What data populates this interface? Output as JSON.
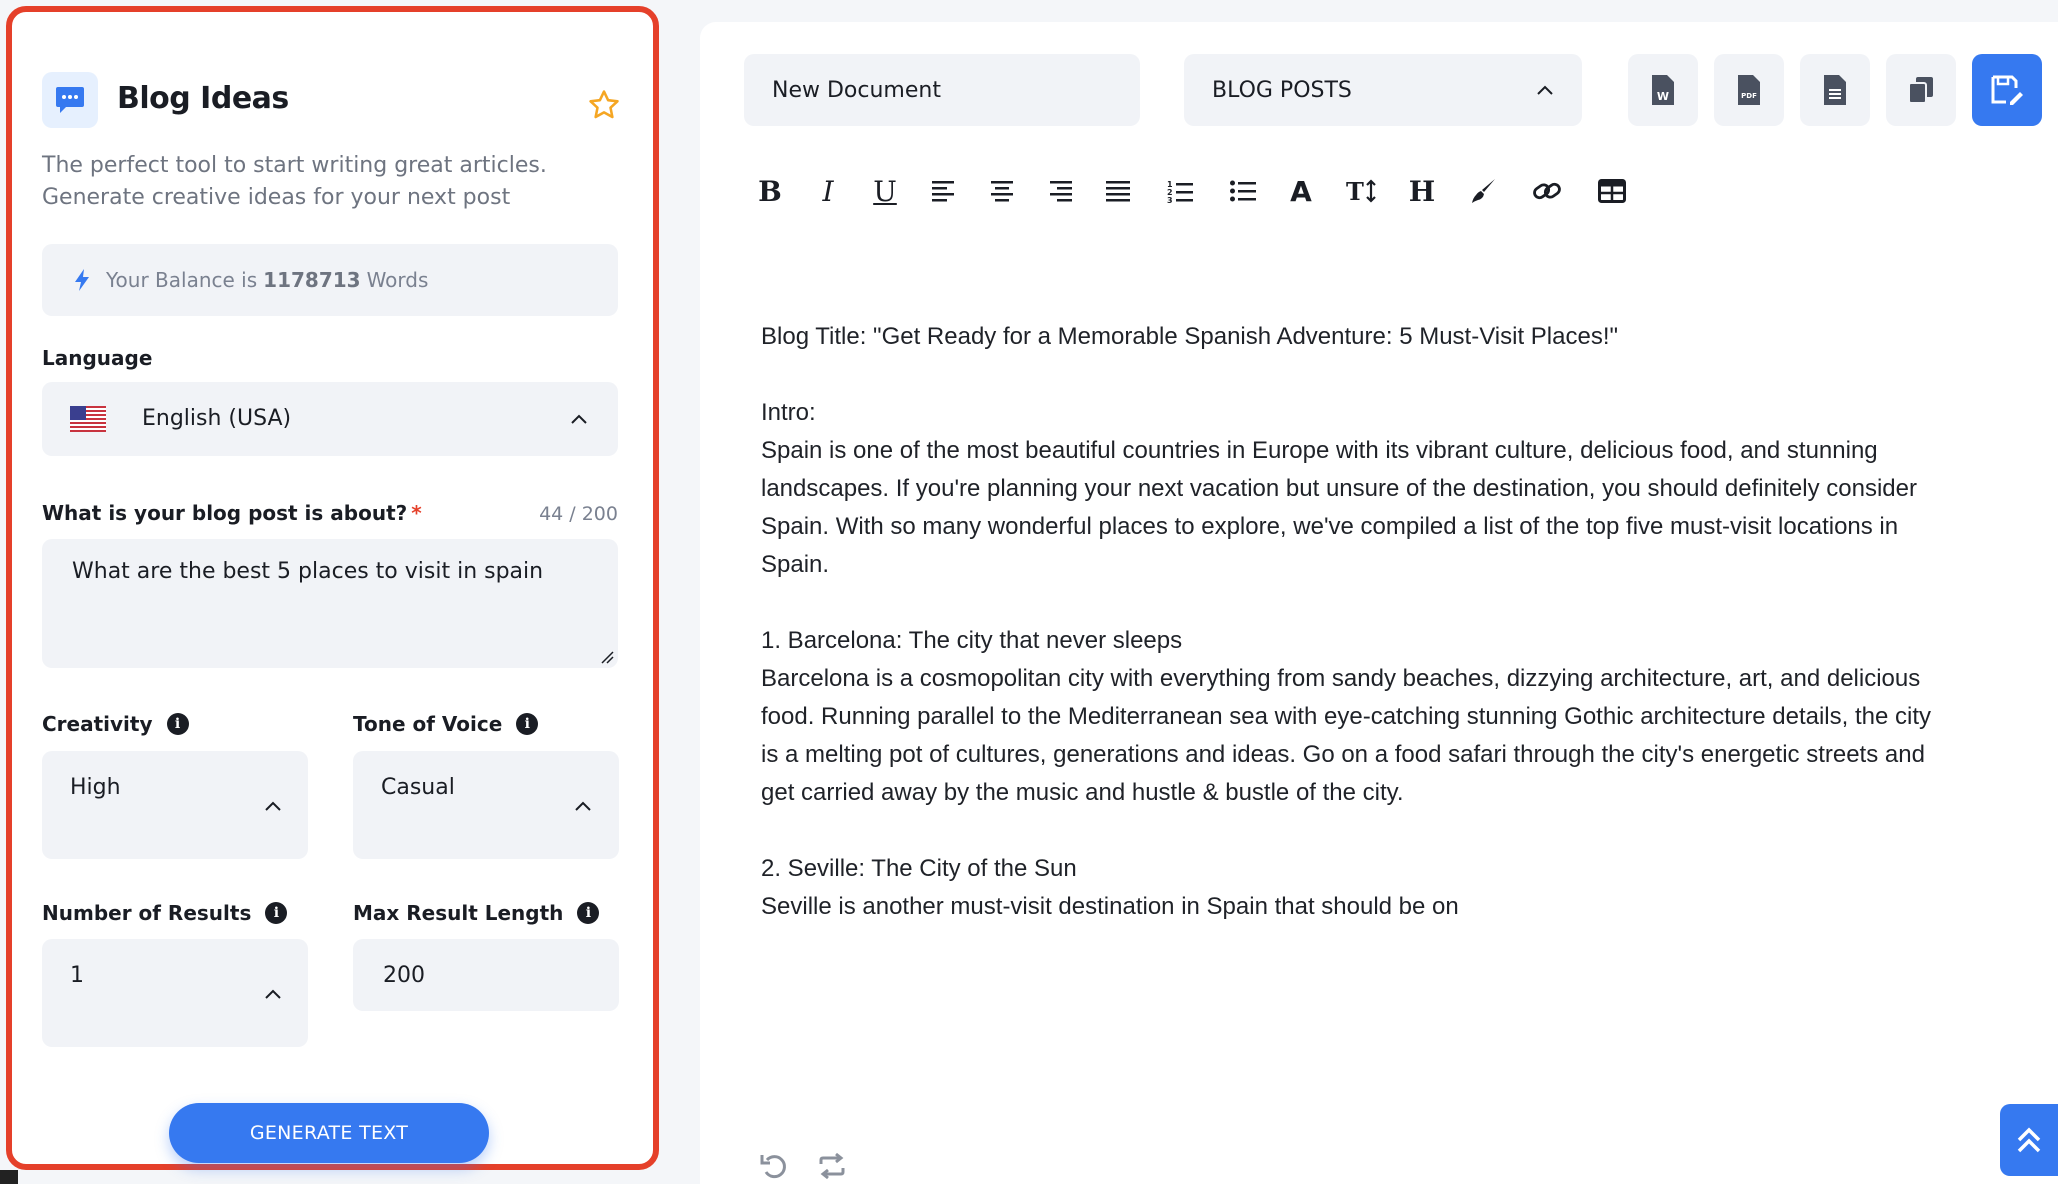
{
  "tool": {
    "title": "Blog Ideas",
    "description_line1": "The perfect tool to start writing great articles.",
    "description_line2": "Generate creative ideas for your next post"
  },
  "balance": {
    "prefix": "Your Balance is",
    "amount": "1178713",
    "suffix": "Words"
  },
  "language": {
    "label": "Language",
    "selected": "English (USA)"
  },
  "topic": {
    "label": "What is your blog post is about?",
    "required_mark": "*",
    "count": "44 / 200",
    "value": "What are the best 5 places to visit in spain"
  },
  "creativity": {
    "label": "Creativity",
    "selected": "High"
  },
  "tone": {
    "label": "Tone of Voice",
    "selected": "Casual"
  },
  "results": {
    "label": "Number of Results",
    "selected": "1"
  },
  "max_length": {
    "label": "Max Result Length",
    "value": "200"
  },
  "generate_label": "GENERATE TEXT",
  "document": {
    "name": "New Document",
    "category": "BLOG POSTS"
  },
  "toolbar": {
    "bold": "B",
    "italic": "I",
    "underline": "U",
    "font": "A",
    "heading": "H"
  },
  "content": {
    "title_line": "Blog Title: \"Get Ready for a Memorable Spanish Adventure: 5 Must-Visit Places!\"",
    "intro_heading": "Intro:",
    "intro_l1": "Spain is one of the most beautiful countries in Europe with its vibrant culture, delicious food, and stunning",
    "intro_l2": "landscapes. If you're planning your next vacation but unsure of the destination, you should definitely consider",
    "intro_l3": "Spain. With so many wonderful places to explore, we've compiled a list of the top five must-visit locations in",
    "intro_l4": "Spain.",
    "p1_heading": "1. Barcelona: The city that never sleeps",
    "p1_l1": "Barcelona is a cosmopolitan city with everything from sandy beaches, dizzying architecture, art, and delicious",
    "p1_l2": "food. Running parallel to the Mediterranean sea with eye-catching stunning Gothic architecture details, the city",
    "p1_l3": "is a melting pot of cultures, generations and ideas. Go on a food safari through the city's energetic streets and",
    "p1_l4": "get carried away by the music and hustle & bustle of the city.",
    "p2_heading": "2. Seville: The City of the Sun",
    "p2_l1": "Seville is another must-visit destination in Spain that should be on"
  },
  "colors": {
    "accent": "#3679f0",
    "highlight_border": "#e5402a",
    "star": "#f5a623"
  }
}
